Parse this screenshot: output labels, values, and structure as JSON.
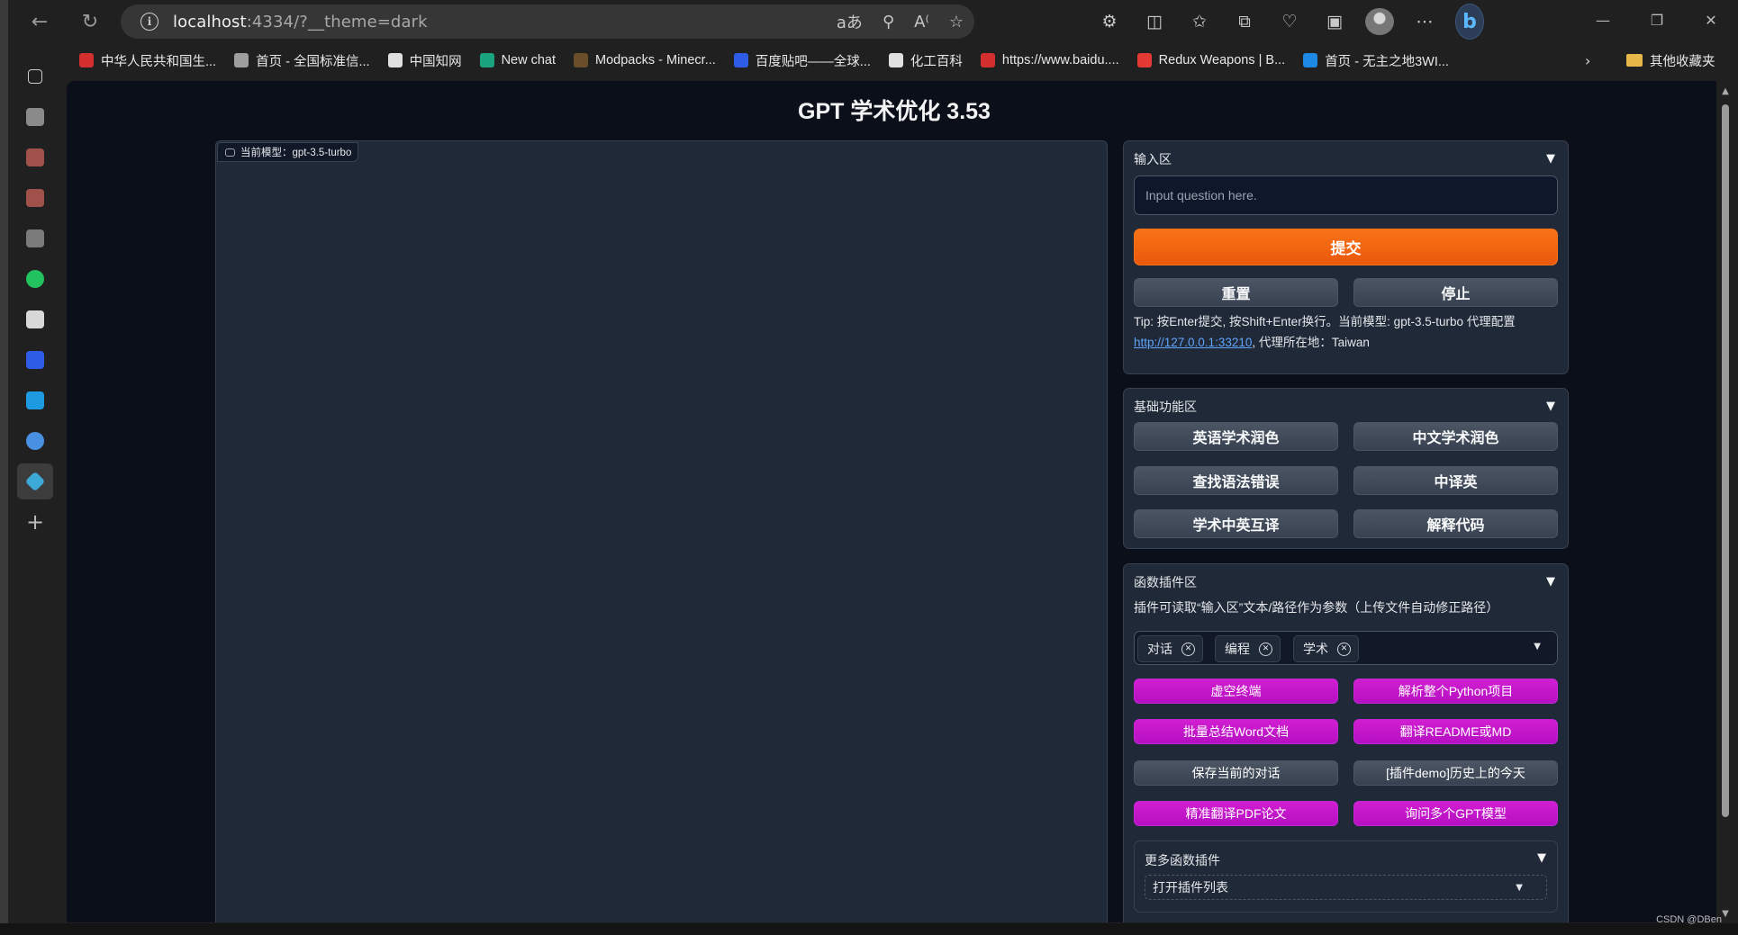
{
  "browser": {
    "url_host": "localhost",
    "url_rest": ":4334/?__theme=dark",
    "icons": [
      "back-icon",
      "refresh-icon",
      "info-icon",
      "read-aloud-icon",
      "zoom-icon",
      "immersive-icon",
      "favorite-icon",
      "extensions-icon",
      "split-screen-icon",
      "favorites-icon",
      "collections-icon",
      "health-icon",
      "screenshot-icon",
      "profile-icon",
      "more-icon",
      "bing-icon"
    ],
    "window_controls": [
      "minimize",
      "restore",
      "close"
    ]
  },
  "favorites": [
    {
      "label": "中华人民共和国生...",
      "color": "#d32f2f"
    },
    {
      "label": "首页 - 全国标准信...",
      "color": "#9e9e9e"
    },
    {
      "label": "中国知网",
      "color": "#e0e0e0"
    },
    {
      "label": "New chat",
      "color": "#19a37f"
    },
    {
      "label": "Modpacks - Minecr...",
      "color": "#6b4f2a"
    },
    {
      "label": "百度贴吧——全球...",
      "color": "#2e5ce6"
    },
    {
      "label": "化工百科",
      "color": "#e0e0e0"
    },
    {
      "label": "https://www.baidu....",
      "color": "#d32f2f"
    },
    {
      "label": "Redux Weapons | B...",
      "color": "#e53935"
    },
    {
      "label": "首页 - 无主之地3WI...",
      "color": "#1e88e5"
    }
  ],
  "favorites_folder": "其他收藏夹",
  "page": {
    "title": "GPT 学术优化 3.53",
    "chat_label": "当前模型：gpt-3.5-turbo"
  },
  "input_area": {
    "heading": "输入区",
    "placeholder": "Input question here.",
    "submit": "提交",
    "reset": "重置",
    "stop": "停止",
    "tip": "Tip: 按Enter提交, 按Shift+Enter换行。当前模型: gpt-3.5-turbo 代理配置 ",
    "proxy_link": "http://127.0.0.1:33210",
    "proxy_suffix": ", 代理所在地：Taiwan"
  },
  "basic": {
    "heading": "基础功能区",
    "buttons": [
      "英语学术润色",
      "中文学术润色",
      "查找语法错误",
      "中译英",
      "学术中英互译",
      "解释代码"
    ]
  },
  "plugins": {
    "heading": "函数插件区",
    "subtitle": "插件可读取“输入区”文本/路径作为参数（上传文件自动修正路径）",
    "tags": [
      "对话",
      "编程",
      "学术"
    ],
    "buttons": [
      {
        "label": "虚空终端",
        "style": "purple"
      },
      {
        "label": "解析整个Python项目",
        "style": "purple"
      },
      {
        "label": "批量总结Word文档",
        "style": "purple"
      },
      {
        "label": "翻译README或MD",
        "style": "purple"
      },
      {
        "label": "保存当前的对话",
        "style": "gray"
      },
      {
        "label": "[插件demo]历史上的今天",
        "style": "gray"
      },
      {
        "label": "精准翻译PDF论文",
        "style": "purple"
      },
      {
        "label": "询问多个GPT模型",
        "style": "purple"
      }
    ],
    "more_heading": "更多函数插件",
    "more_select": "打开插件列表"
  },
  "watermark": "CSDN @DBen"
}
